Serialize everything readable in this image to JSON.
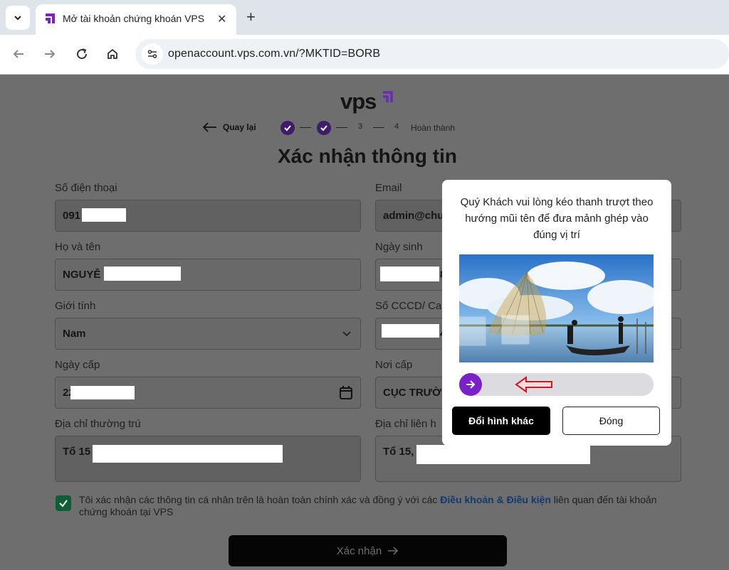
{
  "browser": {
    "tab_title": "Mở tài khoản chứng khoán VPS",
    "url": "openaccount.vps.com.vn/?MKTID=BORB",
    "tab_close": "✕",
    "new_tab": "+"
  },
  "header": {
    "logo_text": "vps",
    "back_label": "Quay lại",
    "steps": [
      {
        "number": "1",
        "status": "done"
      },
      {
        "number": "2",
        "status": "done"
      },
      {
        "number": "3",
        "status": "pending"
      },
      {
        "number": "4",
        "status": "pending"
      }
    ],
    "final_step_label": "Hoàn thành",
    "title": "Xác nhận thông tin"
  },
  "form": {
    "phone": {
      "label": "Số điện thoại",
      "value": "091"
    },
    "email": {
      "label": "Email",
      "value": "admin@chu"
    },
    "full_name": {
      "label": "Họ và tên",
      "value": "NGUYỄ"
    },
    "dob": {
      "label": "Ngày sinh",
      "value": "8"
    },
    "gender": {
      "label": "Giới tính",
      "value": "Nam"
    },
    "id_number": {
      "label": "Số CCCD/ Ca",
      "value": "4"
    },
    "issue_date": {
      "label": "Ngày cấp",
      "value": "22"
    },
    "issue_place": {
      "label": "Nơi cấp",
      "value": "CỤC TRƯỜ"
    },
    "permanent_address": {
      "label": "Địa chỉ thường trú",
      "value": "Tổ 15"
    },
    "contact_address": {
      "label": "Địa chỉ liên h",
      "value": "Tổ 15,"
    }
  },
  "consent": {
    "checked": true,
    "text_before": "Tôi xác nhận các thông tin cá nhân trên là hoàn toàn chính xác và đồng ý với các ",
    "link_text": "Điều khoản & Điều kiện",
    "text_after": " liên quan đến tài khoản chứng khoán tại VPS"
  },
  "confirm_button": "Xác nhận",
  "captcha": {
    "message": "Quý Khách vui lòng kéo thanh trượt theo hướng mũi tên để đưa mảnh ghép vào đúng vị trí",
    "slider_progress": 0,
    "change_button": "Đổi hình khác",
    "close_button": "Đóng"
  },
  "colors": {
    "brand_purple": "#7a21c9",
    "step_done": "#3f1b6b",
    "consent_check": "#0f5d36",
    "arrow_red": "#e0121c"
  }
}
